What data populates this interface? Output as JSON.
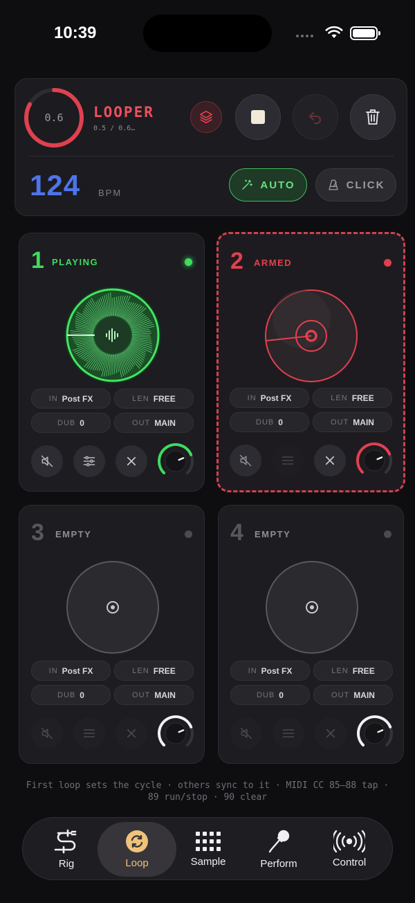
{
  "status": {
    "time": "10:39"
  },
  "header": {
    "progress_value": "0.6",
    "progress_fraction": 0.83,
    "title": "LOOPER",
    "subtitle": "0.5 / 0.6…",
    "bpm": "124",
    "bpm_label": "BPM",
    "auto_label": "AUTO",
    "click_label": "CLICK"
  },
  "colors": {
    "green": "#3fdc5e",
    "red": "#e0414f",
    "blue": "#4f74e8",
    "accent": "#f0c27a"
  },
  "loops": [
    {
      "num": "1",
      "state": "PLAYING",
      "in_key": "IN",
      "in_val": "Post FX",
      "len_key": "LEN",
      "len_val": "FREE",
      "dub_key": "DUB",
      "dub_val": "0",
      "out_key": "OUT",
      "out_val": "MAIN",
      "level": 0.75
    },
    {
      "num": "2",
      "state": "ARMED",
      "in_key": "IN",
      "in_val": "Post FX",
      "len_key": "LEN",
      "len_val": "FREE",
      "dub_key": "DUB",
      "dub_val": "0",
      "out_key": "OUT",
      "out_val": "MAIN",
      "level": 0.75
    },
    {
      "num": "3",
      "state": "EMPTY",
      "in_key": "IN",
      "in_val": "Post FX",
      "len_key": "LEN",
      "len_val": "FREE",
      "dub_key": "DUB",
      "dub_val": "0",
      "out_key": "OUT",
      "out_val": "MAIN",
      "level": 0.75
    },
    {
      "num": "4",
      "state": "EMPTY",
      "in_key": "IN",
      "in_val": "Post FX",
      "len_key": "LEN",
      "len_val": "FREE",
      "dub_key": "DUB",
      "dub_val": "0",
      "out_key": "OUT",
      "out_val": "MAIN",
      "level": 0.75
    }
  ],
  "footnote": {
    "line1": "First loop sets the cycle · others sync to it · MIDI CC 85–88 tap ·",
    "line2": "89 run/stop · 90 clear"
  },
  "tabs": [
    {
      "label": "Rig",
      "icon": "cable-icon"
    },
    {
      "label": "Loop",
      "icon": "loop-icon",
      "active": true
    },
    {
      "label": "Sample",
      "icon": "grid-icon"
    },
    {
      "label": "Perform",
      "icon": "microphone-icon"
    },
    {
      "label": "Control",
      "icon": "broadcast-icon"
    }
  ]
}
